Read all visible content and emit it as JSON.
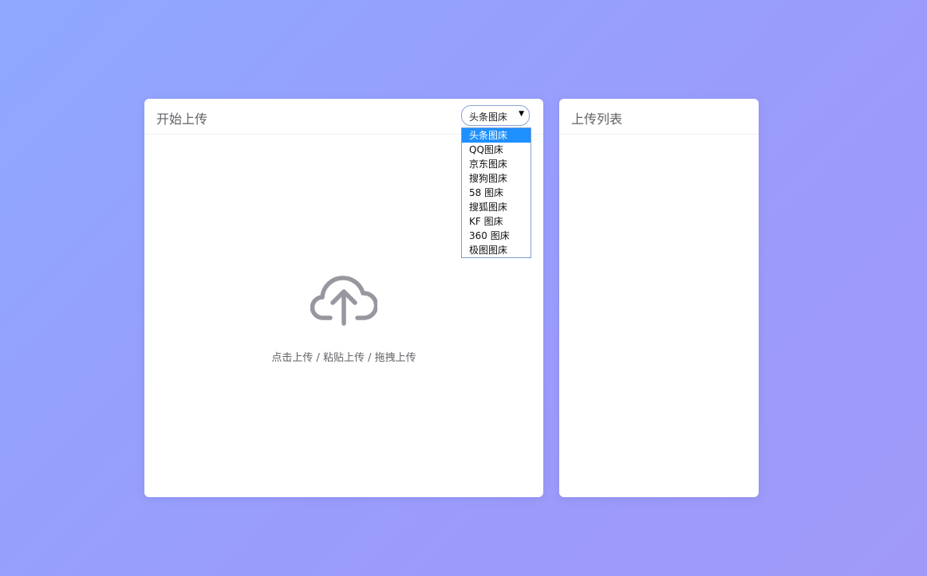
{
  "upload_panel": {
    "title": "开始上传",
    "host_select": {
      "selected": "头条图床",
      "arrow_icon": "triangle-down-icon",
      "options": [
        "头条图床",
        "QQ图床",
        "京东图床",
        "搜狗图床",
        "58 图床",
        "搜狐图床",
        "KF 图床",
        "360 图床",
        "极图图床"
      ]
    },
    "dropzone": {
      "icon": "cloud-upload-icon",
      "hint": "点击上传 / 粘贴上传 / 拖拽上传"
    }
  },
  "list_panel": {
    "title": "上传列表"
  },
  "colors": {
    "background_start": "#8fa8fe",
    "background_end": "#a099f8",
    "selected_option": "#1e90ff",
    "icon": "#97979f"
  }
}
